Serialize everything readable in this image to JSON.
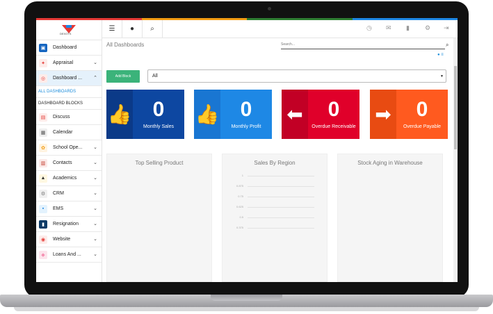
{
  "logo_text": "DEXOTS",
  "colors": {
    "strip": [
      "#e53935",
      "#f39c12",
      "#2e7d32",
      "#1e88e5"
    ]
  },
  "sidebar": {
    "items": [
      {
        "label": "Dashboard",
        "icon": "dashboard-icon",
        "color": "#1565c0",
        "chev": false
      },
      {
        "label": "Appraisal",
        "icon": "appraisal-icon",
        "color": "#e53935",
        "chev": true
      },
      {
        "label": "Dashboard ...",
        "icon": "dashboard-nav-icon",
        "color": "#e53935",
        "chev": true,
        "active": true
      }
    ],
    "sub_items": [
      "ALL DASHBOARDS",
      "DASHBOARD BLOCKS"
    ],
    "items2": [
      {
        "label": "Discuss",
        "icon": "discuss-icon",
        "color": "#e53935"
      },
      {
        "label": "Calendar",
        "icon": "calendar-icon",
        "color": "#555"
      },
      {
        "label": "School Ope...",
        "icon": "school-icon",
        "color": "#f39c12",
        "chev": true
      },
      {
        "label": "Contacts",
        "icon": "contacts-icon",
        "color": "#c0392b",
        "chev": true
      },
      {
        "label": "Academics",
        "icon": "academics-icon",
        "color": "#333",
        "chev": true
      },
      {
        "label": "CRM",
        "icon": "crm-icon",
        "color": "#777",
        "chev": true
      },
      {
        "label": "EMS",
        "icon": "ems-icon",
        "color": "#1e88e5",
        "chev": true
      },
      {
        "label": "Resignation",
        "icon": "resignation-icon",
        "color": "#0d3b66",
        "chev": true
      },
      {
        "label": "Website",
        "icon": "website-icon",
        "color": "#e53935",
        "chev": true
      },
      {
        "label": "Loans And ...",
        "icon": "loans-icon",
        "color": "#f48fb1",
        "chev": true
      }
    ]
  },
  "header": {
    "title": "All Dashboards",
    "search_placeholder": "Search...",
    "add_block_label": "Add Block",
    "select_value": "All"
  },
  "cards": [
    {
      "value": "0",
      "label": "Monthly Sales",
      "color": "#0d47a1",
      "icon_color": "#0b3a88",
      "icon": "thumbs-up-icon"
    },
    {
      "value": "0",
      "label": "Monthly Profit",
      "color": "#1e88e5",
      "icon_color": "#1976d2",
      "icon": "thumbs-up-icon"
    },
    {
      "value": "0",
      "label": "Overdue Receivable",
      "color": "#e0002a",
      "icon_color": "#c20025",
      "icon": "arrow-left-icon"
    },
    {
      "value": "0",
      "label": "Overdue Payable",
      "color": "#ff5a1f",
      "icon_color": "#e84b12",
      "icon": "arrow-right-icon"
    }
  ],
  "panels": [
    {
      "title": "Top Selling Product"
    },
    {
      "title": "Sales By Region",
      "ticks": [
        "1",
        "0.875",
        "0.75",
        "0.625",
        "0.5",
        "0.375"
      ]
    },
    {
      "title": "Stock Aging in Warehouse"
    }
  ]
}
